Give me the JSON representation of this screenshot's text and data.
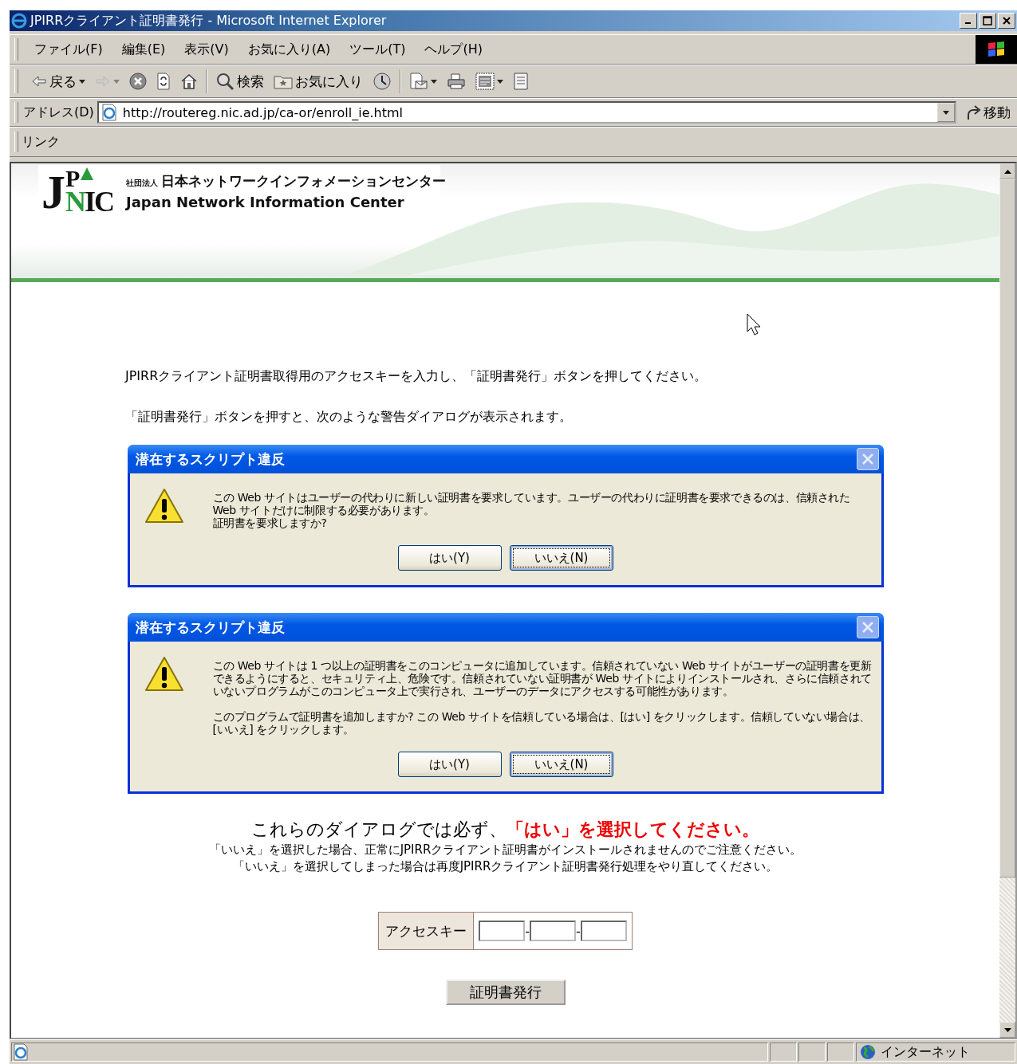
{
  "window": {
    "title": "JPIRRクライアント証明書発行 - Microsoft Internet Explorer"
  },
  "menu": [
    "ファイル(F)",
    "編集(E)",
    "表示(V)",
    "お気に入り(A)",
    "ツール(T)",
    "ヘルプ(H)"
  ],
  "toolbar": [
    {
      "kind": "back",
      "label": "戻る",
      "dropdown": true,
      "disabled": false
    },
    {
      "kind": "forward",
      "dropdown": true,
      "disabled": true
    },
    {
      "kind": "stop",
      "dropdown": false,
      "disabled": false
    },
    {
      "kind": "refresh",
      "dropdown": false,
      "disabled": false
    },
    {
      "kind": "home",
      "dropdown": false,
      "disabled": false
    },
    {
      "kind": "separator"
    },
    {
      "kind": "search",
      "label": "検索",
      "dropdown": false,
      "disabled": false
    },
    {
      "kind": "favorites",
      "label": "お気に入り",
      "dropdown": false,
      "disabled": false
    },
    {
      "kind": "history",
      "dropdown": false,
      "disabled": false
    },
    {
      "kind": "separator"
    },
    {
      "kind": "mail",
      "dropdown": true,
      "disabled": false
    },
    {
      "kind": "print",
      "dropdown": false,
      "disabled": false
    },
    {
      "kind": "edit",
      "dropdown": true,
      "disabled": false
    },
    {
      "kind": "discuss",
      "dropdown": false,
      "disabled": false
    }
  ],
  "address": {
    "label": "アドレス(D)",
    "url": "http://routereg.nic.ad.jp/ca-or/enroll_ie.html",
    "go": "移動"
  },
  "links": {
    "label": "リンク"
  },
  "banner": {
    "logo": "JPNIC",
    "org_type": "社団法人",
    "name_ja": "日本ネットワークインフォメーションセンター",
    "name_en": "Japan Network Information Center"
  },
  "instructions": [
    "JPIRRクライアント証明書取得用のアクセスキーを入力し、「証明書発行」ボタンを押してください。",
    "「証明書発行」ボタンを押すと、次のような警告ダイアログが表示されます。"
  ],
  "dialogs": [
    {
      "title": "潜在するスクリプト違反",
      "paragraphs": [
        [
          "この Web サイトはユーザーの代わりに新しい証明書を要求しています。ユーザーの代わりに証明書を要求できるのは、信頼された Web サイトだけに制限する必要があります。",
          "証明書を要求しますか?"
        ]
      ],
      "buttons": [
        {
          "label": "はい(Y)",
          "focused": false
        },
        {
          "label": "いいえ(N)",
          "focused": true
        }
      ]
    },
    {
      "title": "潜在するスクリプト違反",
      "paragraphs": [
        [
          "この Web サイトは 1 つ以上の証明書をこのコンピュータに追加しています。信頼されていない Web サイトがユーザーの証明書を更新できるようにすると、セキュリティ上、危険です。信頼されていない証明書が Web サイトによりインストールされ、さらに信頼されていないプログラムがこのコンピュータ上で実行され、ユーザーのデータにアクセスする可能性があります。"
        ],
        [
          "このプログラムで証明書を追加しますか? この Web サイトを信頼している場合は、[はい] をクリックします。信頼していない場合は、[いいえ] をクリックします。"
        ]
      ],
      "buttons": [
        {
          "label": "はい(Y)",
          "focused": false
        },
        {
          "label": "いいえ(N)",
          "focused": true
        }
      ]
    }
  ],
  "notice": {
    "lead": "これらのダイアログでは必ず、",
    "emphasis": "「はい」を選択してください。",
    "lines": [
      "「いいえ」を選択した場合、正常にJPIRRクライアント証明書がインストールされませんのでご注意ください。",
      "「いいえ」を選択してしまった場合は再度JPIRRクライアント証明書発行処理をやり直してください。"
    ]
  },
  "form": {
    "label": "アクセスキー",
    "fields": [
      {
        "kind": "text"
      },
      {
        "kind": "text"
      },
      {
        "kind": "text"
      }
    ],
    "separator": "-",
    "submit": "証明書発行"
  },
  "status_bar": {
    "zone": "インターネット"
  }
}
